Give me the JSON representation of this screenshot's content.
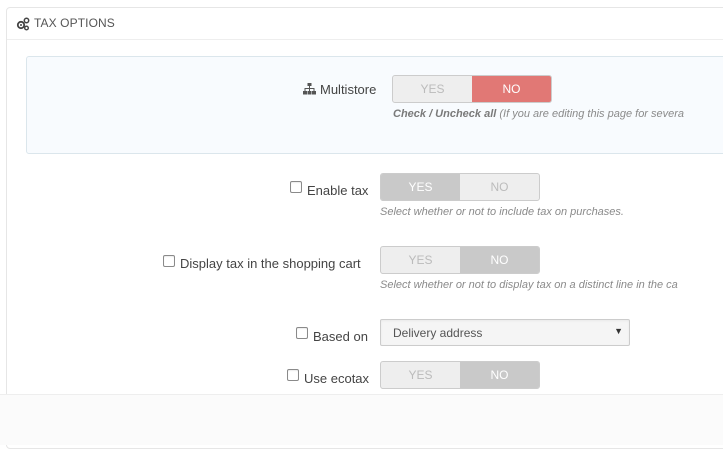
{
  "panel": {
    "title": "TAX OPTIONS",
    "icon": "gears-icon"
  },
  "multistore": {
    "label": "Multistore",
    "icon": "sitemap-icon",
    "yes": "YES",
    "no": "NO",
    "selected": "NO",
    "help_bold": "Check / Uncheck all",
    "help_text": " (If you are editing this page for severa"
  },
  "enable_tax": {
    "label": "Enable tax",
    "yes": "YES",
    "no": "NO",
    "selected": "YES",
    "help": "Select whether or not to include tax on purchases."
  },
  "display_tax": {
    "label": "Display tax in the shopping cart",
    "yes": "YES",
    "no": "NO",
    "selected": "NO",
    "help": "Select whether or not to display tax on a distinct line in the ca"
  },
  "based_on": {
    "label": "Based on",
    "value": "Delivery address"
  },
  "use_ecotax": {
    "label": "Use ecotax",
    "yes": "YES",
    "no": "NO",
    "selected": "NO"
  },
  "colors": {
    "active_red": "#e17875",
    "active_gray": "#c9c9c9"
  }
}
